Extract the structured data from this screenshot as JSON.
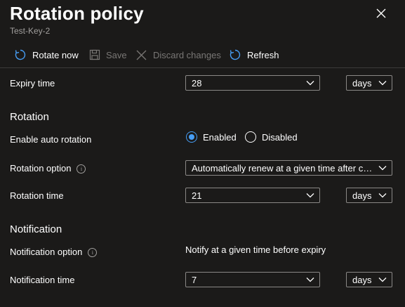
{
  "header": {
    "title": "Rotation policy",
    "subtitle": "Test-Key-2"
  },
  "toolbar": {
    "rotate_now": "Rotate now",
    "save": "Save",
    "discard": "Discard changes",
    "refresh": "Refresh"
  },
  "expiry": {
    "label": "Expiry time",
    "value": "28",
    "unit": "days"
  },
  "rotation": {
    "heading": "Rotation",
    "auto_label": "Enable auto rotation",
    "enabled_label": "Enabled",
    "disabled_label": "Disabled",
    "selected": "Enabled",
    "option_label": "Rotation option",
    "option_value": "Automatically renew at a given time after creation",
    "time_label": "Rotation time",
    "time_value": "21",
    "time_unit": "days"
  },
  "notification": {
    "heading": "Notification",
    "option_label": "Notification option",
    "option_value": "Notify at a given time before expiry",
    "time_label": "Notification time",
    "time_value": "7",
    "time_unit": "days"
  },
  "colors": {
    "background": "#1b1a19",
    "accent": "#479ef5",
    "border": "#8a8886",
    "disabled_text": "#797775"
  }
}
